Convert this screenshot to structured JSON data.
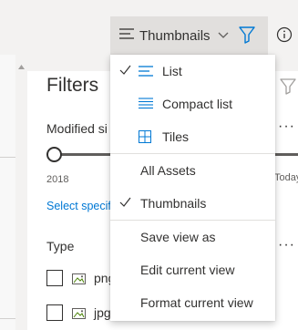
{
  "toolbar": {
    "view_label": "Thumbnails"
  },
  "filters": {
    "title": "Filters",
    "modified_label": "Modified si",
    "more": "···",
    "start_label": "2018",
    "end_label": "Today",
    "select_link": "Select specif",
    "type_label": "Type",
    "types": [
      {
        "ext": "png"
      },
      {
        "ext": "jpg"
      }
    ]
  },
  "view_menu": {
    "items": [
      {
        "label": "List",
        "checked": true,
        "icon": "list-icon"
      },
      {
        "label": "Compact list",
        "checked": false,
        "icon": "compact-list-icon"
      },
      {
        "label": "Tiles",
        "checked": false,
        "icon": "tiles-icon"
      },
      {
        "label": "All Assets",
        "checked": false
      },
      {
        "label": "Thumbnails",
        "checked": true
      },
      {
        "label": "Save view as",
        "checked": false
      },
      {
        "label": "Edit current view",
        "checked": false
      },
      {
        "label": "Format current view",
        "checked": false
      }
    ]
  },
  "colors": {
    "accent": "#0078d4",
    "text": "#323130",
    "toolbar_bg": "#f3f2f1"
  }
}
